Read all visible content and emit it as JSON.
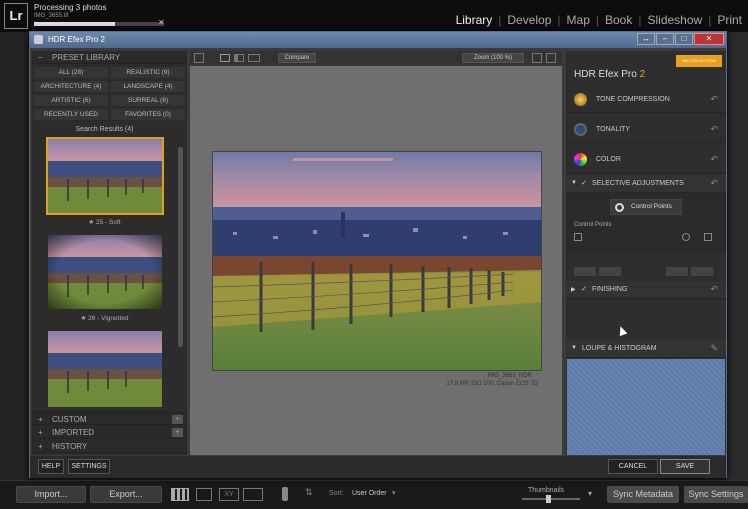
{
  "lightroom": {
    "logo": "Lr",
    "status": "Processing 3 photos",
    "filename": "IMG_3655.tif",
    "progress": 0.62,
    "modules": [
      "Library",
      "Develop",
      "Map",
      "Book",
      "Slideshow",
      "Print"
    ],
    "active_module": "Library",
    "separator": "|",
    "bottom": {
      "import": "Import...",
      "export": "Export...",
      "sort_label": "Sort:",
      "sort_value": "User Order",
      "thumbnails_label": "Thumbnails",
      "sync_metadata": "Sync Metadata",
      "sync_settings": "Sync Settings"
    }
  },
  "dialog": {
    "title": "HDR Efex Pro 2",
    "preset_library": "PRESET LIBRARY",
    "filters": [
      {
        "label": "ALL (28)"
      },
      {
        "label": "REALISTIC (9)"
      },
      {
        "label": "ARCHITECTURE (4)"
      },
      {
        "label": "LANDSCAPE (4)"
      },
      {
        "label": "ARTISTIC (6)"
      },
      {
        "label": "SURREAL (6)"
      },
      {
        "label": "RECENTLY USED"
      },
      {
        "label": "FAVORITES (0)"
      }
    ],
    "search_results": "Search Results (4)",
    "presets": [
      {
        "label": "★ 25 - Soft"
      },
      {
        "label": "★ 26 - Vignetted"
      },
      {
        "label": ""
      }
    ],
    "sections": {
      "custom": "CUSTOM",
      "imported": "IMPORTED",
      "history": "HISTORY"
    },
    "help": "HELP",
    "settings": "SETTINGS",
    "toolbar": {
      "compare": "Compare",
      "zoom": "Zoom (100 %)"
    },
    "photo_caption_1": "IMG_3653_HDR",
    "photo_caption_2": "17.9 MP, ISO 100, Canon EOS 7D",
    "right": {
      "brand": "HDR Efex Pro",
      "brand_num": "2",
      "badge": "NIK COLLECTION",
      "tone_compression": "TONE COMPRESSION",
      "tonality": "TONALITY",
      "color": "COLOR",
      "selective": "SELECTIVE ADJUSTMENTS",
      "control_points": "Control Points",
      "control_points_sub": "Control Points",
      "finishing": "FINISHING",
      "loupe": "LOUPE & HISTOGRAM"
    },
    "cancel": "CANCEL",
    "save": "SAVE"
  }
}
